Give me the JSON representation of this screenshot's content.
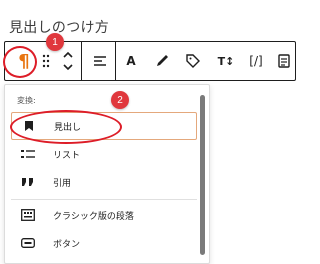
{
  "page": {
    "heading": "見出しのつけ方"
  },
  "toolbar": {
    "paragraph_glyph": "¶",
    "bold_glyph": "A",
    "text_size_glyph": "T↕",
    "code_glyph": "[/]"
  },
  "badges": {
    "one": "1",
    "two": "2"
  },
  "menu": {
    "section_label": "変換:",
    "items": [
      {
        "label": "見出し",
        "icon": "bookmark-icon"
      },
      {
        "label": "リスト",
        "icon": "list-icon"
      },
      {
        "label": "引用",
        "icon": "quote-icon"
      },
      {
        "label": "クラシック版の段落",
        "icon": "classic-icon"
      },
      {
        "label": "ボタン",
        "icon": "button-icon"
      }
    ]
  },
  "colors": {
    "accent": "#e87410",
    "highlight": "#dd1d28",
    "badge": "#e0383d"
  }
}
